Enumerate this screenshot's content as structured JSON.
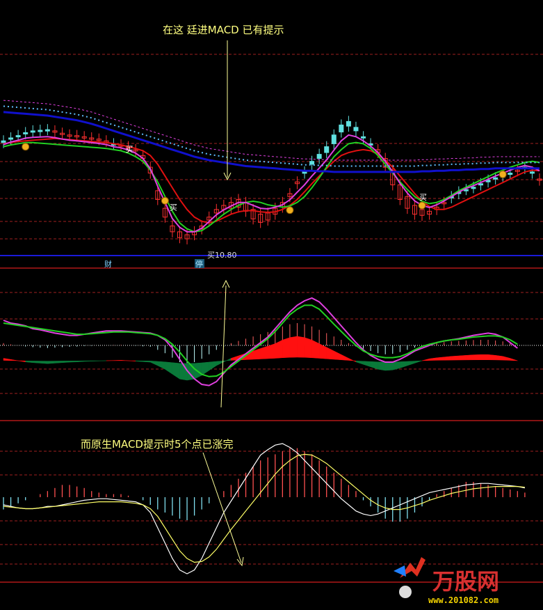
{
  "annotations": {
    "top_note": "在这 廷进MACD 已有提示",
    "bottom_note": "而原生MACD提示时5个点已涨完",
    "buy_signal": "买",
    "buy_price_label": "买10.80",
    "marker_cai": "财",
    "marker_ting": "停"
  },
  "watermark": {
    "brand": "万股网",
    "url": "www.201082.com"
  },
  "colors": {
    "background": "#000000",
    "candle_up": "#ff3030",
    "candle_down": "#60e0e0",
    "ma_green": "#22d022",
    "ma_red": "#e01010",
    "ma_magenta": "#e040e0",
    "ma_blue": "#1010cc",
    "dotted_blue": "#60c0ff",
    "dashed_grid": "#a02020",
    "ribbon_red": "#ff1010",
    "ribbon_green": "#0a7a3a",
    "signal_yellow": "#ffff66",
    "coin": "#f0b020"
  },
  "chart_data": [
    {
      "type": "candlestick",
      "panel": "price",
      "series": [
        {
          "name": "",
          "values": [
            148,
            142,
            138,
            133,
            130,
            128,
            126,
            128,
            132,
            135,
            136,
            138,
            140,
            142,
            145,
            150,
            152,
            155,
            160,
            170,
            190,
            230,
            260,
            290,
            300,
            305,
            300,
            290,
            275,
            262,
            255,
            250,
            245,
            250,
            262,
            270,
            268,
            260,
            250,
            235,
            215,
            200,
            185,
            175,
            165,
            150,
            130,
            120,
            128,
            140,
            150,
            160,
            175,
            195,
            220,
            240,
            255,
            262,
            265,
            258,
            250,
            242,
            235,
            228,
            225,
            220,
            215,
            210,
            205,
            200,
            195,
            192,
            200,
            210
          ]
        },
        {
          "name": "",
          "values": [
            145,
            140,
            136,
            131,
            128,
            127,
            126,
            129,
            133,
            136,
            137,
            139,
            141,
            143,
            146,
            150,
            153,
            156,
            162,
            175,
            200,
            245,
            275,
            300,
            310,
            312,
            305,
            295,
            280,
            268,
            262,
            260,
            258,
            265,
            278,
            284,
            280,
            270,
            258,
            240,
            218,
            198,
            180,
            168,
            155,
            135,
            118,
            112,
            122,
            138,
            150,
            165,
            190,
            220,
            245,
            260,
            270,
            272,
            270,
            262,
            252,
            240,
            232,
            228,
            224,
            218,
            212,
            208,
            205,
            200,
            196,
            190,
            198,
            212
          ]
        },
        {
          "name": "",
          "values": [
            150,
            148,
            146,
            145,
            144,
            143,
            142,
            141,
            142,
            143,
            144,
            145,
            146,
            147,
            148,
            150,
            152,
            155,
            158,
            162,
            170,
            185,
            205,
            225,
            245,
            262,
            275,
            282,
            285,
            282,
            276,
            270,
            266,
            264,
            264,
            266,
            267,
            266,
            262,
            255,
            245,
            232,
            218,
            205,
            192,
            180,
            170,
            165,
            162,
            160,
            162,
            168,
            178,
            190,
            205,
            220,
            235,
            248,
            257,
            262,
            262,
            258,
            252,
            246,
            240,
            234,
            228,
            222,
            216,
            210,
            204,
            198,
            195,
            196
          ]
        },
        {
          "name": "",
          "values": [
            155,
            152,
            150,
            148,
            148,
            149,
            150,
            151,
            152,
            153,
            154,
            155,
            156,
            157,
            158,
            160,
            162,
            166,
            172,
            180,
            195,
            215,
            240,
            265,
            285,
            295,
            300,
            298,
            290,
            280,
            270,
            262,
            255,
            250,
            248,
            250,
            254,
            256,
            258,
            256,
            250,
            240,
            225,
            208,
            190,
            172,
            160,
            150,
            148,
            150,
            158,
            170,
            185,
            200,
            215,
            228,
            240,
            248,
            252,
            250,
            245,
            238,
            230,
            224,
            218,
            212,
            206,
            200,
            195,
            190,
            186,
            182,
            180,
            182
          ]
        },
        {
          "name": "",
          "values": [
            96,
            97,
            98,
            99,
            100,
            101,
            102,
            104,
            106,
            108,
            110,
            113,
            116,
            120,
            124,
            128,
            132,
            136,
            140,
            144,
            148,
            152,
            156,
            160,
            164,
            168,
            172,
            175,
            178,
            180,
            182,
            184,
            186,
            188,
            189,
            190,
            191,
            192,
            193,
            194,
            195,
            196,
            196,
            197,
            197,
            198,
            198,
            198,
            198,
            198,
            198,
            198,
            198,
            198,
            198,
            198,
            198,
            197,
            197,
            196,
            196,
            195,
            195,
            194,
            194,
            193,
            193,
            192,
            192,
            192,
            192,
            192,
            192,
            192
          ]
        }
      ],
      "grid": true
    },
    {
      "type": "area",
      "panel": "enhanced_macd",
      "series": [
        {
          "name": "",
          "values": [
            45,
            40,
            38,
            35,
            30,
            28,
            25,
            22,
            20,
            18,
            18,
            20,
            22,
            24,
            26,
            26,
            26,
            25,
            24,
            23,
            22,
            18,
            10,
            -5,
            -25,
            -45,
            -60,
            -70,
            -72,
            -65,
            -50,
            -35,
            -25,
            -15,
            -5,
            5,
            15,
            30,
            45,
            60,
            72,
            80,
            85,
            78,
            65,
            50,
            35,
            20,
            5,
            -8,
            -18,
            -25,
            -30,
            -30,
            -25,
            -18,
            -10,
            -5,
            0,
            5,
            8,
            10,
            12,
            15,
            18,
            20,
            22,
            20,
            15,
            5,
            -5
          ]
        },
        {
          "name": "",
          "values": [
            40,
            38,
            36,
            34,
            32,
            30,
            28,
            26,
            24,
            22,
            20,
            20,
            21,
            22,
            23,
            24,
            24,
            24,
            23,
            22,
            21,
            18,
            12,
            2,
            -12,
            -28,
            -42,
            -52,
            -56,
            -55,
            -48,
            -38,
            -28,
            -18,
            -8,
            2,
            12,
            25,
            40,
            55,
            65,
            72,
            72,
            65,
            52,
            38,
            25,
            12,
            0,
            -10,
            -16,
            -20,
            -22,
            -22,
            -20,
            -15,
            -8,
            -2,
            2,
            5,
            8,
            10,
            11,
            13,
            15,
            16,
            17,
            17,
            15,
            10,
            2
          ]
        },
        {
          "name": "",
          "values": [
            10,
            5,
            0,
            -5,
            -8,
            -10,
            -12,
            -10,
            -8,
            -6,
            -5,
            -3,
            -2,
            -1,
            0,
            1,
            2,
            0,
            -2,
            -4,
            -6,
            -20,
            -35,
            -55,
            -75,
            -80,
            -75,
            -60,
            -40,
            -20,
            -5,
            10,
            20,
            30,
            40,
            50,
            60,
            70,
            85,
            95,
            100,
            95,
            85,
            70,
            55,
            40,
            25,
            10,
            -5,
            -15,
            -25,
            -35,
            -40,
            -38,
            -30,
            -20,
            -10,
            0,
            8,
            12,
            15,
            18,
            20,
            22,
            24,
            25,
            25,
            22,
            18,
            10,
            0
          ]
        }
      ],
      "grid": true
    },
    {
      "type": "bar",
      "panel": "standard_macd",
      "series": [
        {
          "name": "",
          "values": [
            -8,
            -6,
            -4,
            -2,
            0,
            2,
            4,
            6,
            8,
            8,
            7,
            6,
            4,
            3,
            2,
            2,
            2,
            1,
            0,
            -2,
            -5,
            -8,
            -10,
            -12,
            -14,
            -15,
            -12,
            -8,
            -4,
            0,
            4,
            8,
            12,
            16,
            20,
            24,
            26,
            28,
            30,
            32,
            32,
            30,
            28,
            24,
            20,
            16,
            12,
            8,
            4,
            -2,
            -6,
            -10,
            -14,
            -16,
            -16,
            -14,
            -10,
            -6,
            -2,
            2,
            4,
            6,
            8,
            10,
            10,
            9,
            8,
            7,
            6,
            5,
            4,
            3
          ]
        },
        {
          "name": "",
          "values": [
            -10,
            -12,
            -14,
            -15,
            -15,
            -14,
            -12,
            -12,
            -10,
            -8,
            -6,
            -4,
            -3,
            -2,
            -2,
            -3,
            -4,
            -5,
            -6,
            -10,
            -20,
            -40,
            -60,
            -80,
            -95,
            -100,
            -95,
            -80,
            -60,
            -40,
            -20,
            -5,
            10,
            25,
            40,
            55,
            62,
            68,
            70,
            65,
            58,
            48,
            38,
            28,
            18,
            8,
            -2,
            -10,
            -18,
            -22,
            -24,
            -22,
            -18,
            -14,
            -10,
            -6,
            -2,
            2,
            6,
            8,
            10,
            12,
            14,
            16,
            17,
            18,
            18,
            17,
            16,
            15,
            14,
            12
          ]
        },
        {
          "name": "",
          "values": [
            -12,
            -13,
            -14,
            -15,
            -15,
            -14,
            -13,
            -12,
            -11,
            -10,
            -9,
            -8,
            -7,
            -6,
            -6,
            -6,
            -6,
            -7,
            -8,
            -10,
            -15,
            -25,
            -40,
            -55,
            -70,
            -80,
            -85,
            -84,
            -78,
            -68,
            -55,
            -42,
            -30,
            -18,
            -6,
            6,
            18,
            30,
            40,
            48,
            54,
            56,
            55,
            50,
            44,
            36,
            28,
            20,
            12,
            4,
            -4,
            -10,
            -14,
            -16,
            -16,
            -14,
            -11,
            -8,
            -4,
            -1,
            2,
            5,
            7,
            9,
            11,
            12,
            13,
            14,
            14,
            14,
            14,
            13
          ]
        }
      ],
      "grid": true
    }
  ]
}
